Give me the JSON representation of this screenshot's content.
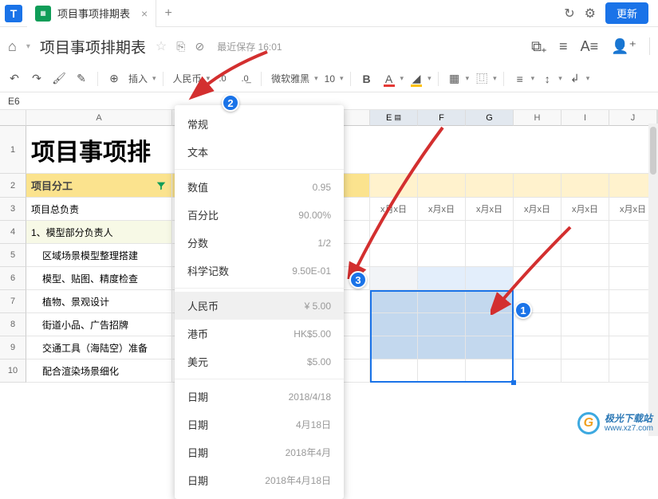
{
  "titlebar": {
    "logo_letter": "T",
    "tab_title": "项目事项排期表",
    "update_btn": "更新"
  },
  "header": {
    "doc_title": "项目事项排期表",
    "save_status": "最近保存 16:01"
  },
  "toolbar": {
    "insert_label": "插入",
    "currency_label": "人民币",
    "font_label": "微软雅黑",
    "font_size": "10",
    "bold": "B"
  },
  "refbar": {
    "cell": "E6"
  },
  "columns": [
    "",
    "A",
    "",
    "E",
    "F",
    "G",
    "H",
    "I",
    "J"
  ],
  "rows": {
    "big_title": "项目事项排",
    "r2_a": "项目分工",
    "r3_a": "项目总负责",
    "r3_dates": [
      "x月x日",
      "x月x日",
      "x月x日",
      "x月x日",
      "x月x日",
      "x月x日"
    ],
    "r4_a": "1、模型部分负责人",
    "r5_a": "区域场景模型整理搭建",
    "r6_a": "模型、贴图、精度检查",
    "r7_a": "植物、景观设计",
    "r8_a": "街道小品、广告招牌",
    "r9_a": "交通工具（海陆空）准备",
    "r10_a": "配合渲染场景细化"
  },
  "menu": {
    "items": [
      {
        "label": "常规",
        "value": ""
      },
      {
        "label": "文本",
        "value": ""
      },
      {
        "sep": true
      },
      {
        "label": "数值",
        "value": "0.95"
      },
      {
        "label": "百分比",
        "value": "90.00%"
      },
      {
        "label": "分数",
        "value": "1/2"
      },
      {
        "label": "科学记数",
        "value": "9.50E-01"
      },
      {
        "sep": true
      },
      {
        "label": "人民币",
        "value": "¥ 5.00",
        "hover": true
      },
      {
        "label": "港币",
        "value": "HK$5.00"
      },
      {
        "label": "美元",
        "value": "$5.00"
      },
      {
        "sep": true
      },
      {
        "label": "日期",
        "value": "2018/4/18"
      },
      {
        "label": "日期",
        "value": "4月18日"
      },
      {
        "label": "日期",
        "value": "2018年4月"
      },
      {
        "label": "日期",
        "value": "2018年4月18日"
      }
    ]
  },
  "badges": {
    "b1": "1",
    "b2": "2",
    "b3": "3"
  },
  "watermark": {
    "logo": "G",
    "cn": "极光下载站",
    "url": "www.xz7.com"
  }
}
